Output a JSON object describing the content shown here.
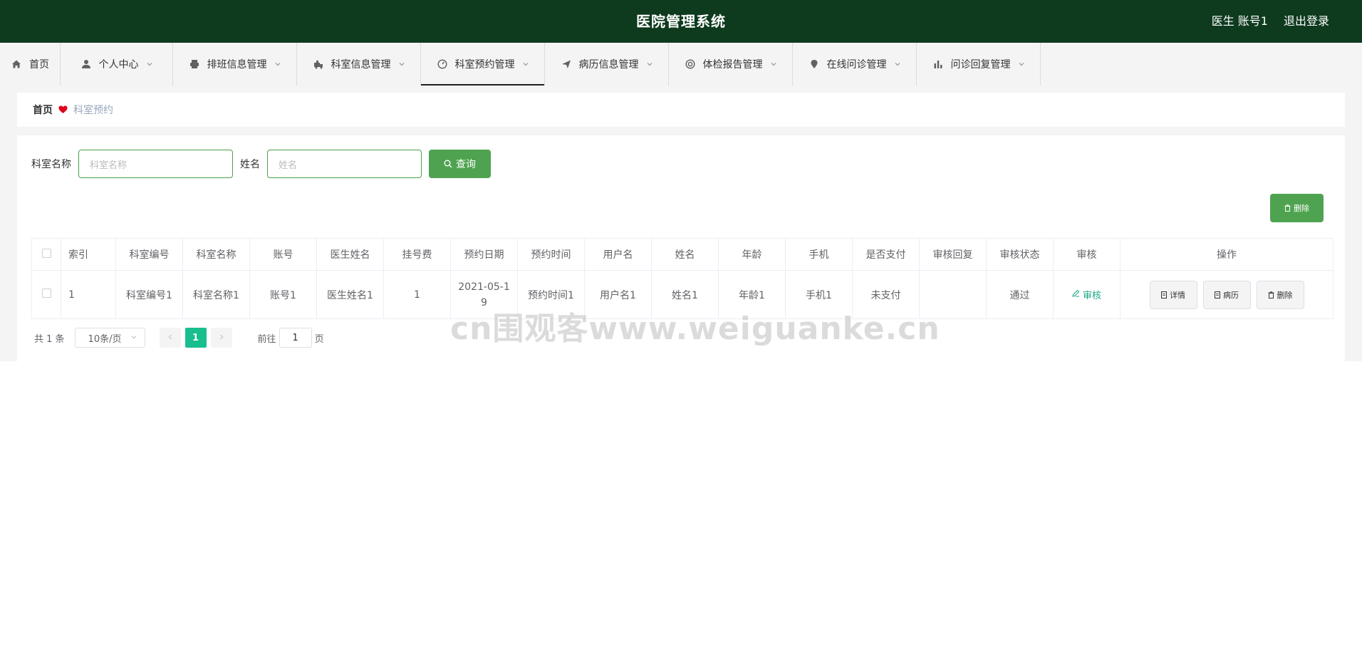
{
  "header": {
    "title": "医院管理系统",
    "user_label": "医生 账号1",
    "logout_label": "退出登录",
    "bg_color": "#0e3a1e"
  },
  "nav": {
    "items": [
      {
        "label": "首页",
        "icon": "home-icon",
        "has_dropdown": false
      },
      {
        "label": "个人中心",
        "icon": "user-icon",
        "has_dropdown": true
      },
      {
        "label": "排班信息管理",
        "icon": "printer-icon",
        "has_dropdown": true
      },
      {
        "label": "科室信息管理",
        "icon": "truck-icon",
        "has_dropdown": true
      },
      {
        "label": "科室预约管理",
        "icon": "dashboard-icon",
        "has_dropdown": true,
        "active": true
      },
      {
        "label": "病历信息管理",
        "icon": "send-icon",
        "has_dropdown": true
      },
      {
        "label": "体检报告管理",
        "icon": "lifebuoy-icon",
        "has_dropdown": true
      },
      {
        "label": "在线问诊管理",
        "icon": "location-pin-icon",
        "has_dropdown": true
      },
      {
        "label": "问诊回复管理",
        "icon": "bar-chart-icon",
        "has_dropdown": true
      }
    ]
  },
  "breadcrumb": {
    "home": "首页",
    "current": "科室预约"
  },
  "search": {
    "dept_label": "科室名称",
    "dept_placeholder": "科室名称",
    "name_label": "姓名",
    "name_placeholder": "姓名",
    "query_label": "查询"
  },
  "toolbar": {
    "delete_label": "删除"
  },
  "table": {
    "headers": [
      "索引",
      "科室编号",
      "科室名称",
      "账号",
      "医生姓名",
      "挂号费",
      "预约日期",
      "预约时间",
      "用户名",
      "姓名",
      "年龄",
      "手机",
      "是否支付",
      "审核回复",
      "审核状态",
      "审核",
      "操作"
    ],
    "rows": [
      {
        "index": "1",
        "dept_no": "科室编号1",
        "dept_name": "科室名称1",
        "account": "账号1",
        "doctor": "医生姓名1",
        "fee": "1",
        "date": "2021-05-19",
        "time": "预约时间1",
        "username": "用户名1",
        "name": "姓名1",
        "age": "年龄1",
        "phone": "手机1",
        "paid": "未支付",
        "reply": "",
        "status": "通过",
        "audit_label": "审核",
        "actions": {
          "detail": "详情",
          "record": "病历",
          "delete": "删除"
        }
      }
    ]
  },
  "pagination": {
    "total": "共 1 条",
    "page_size": "10条/页",
    "current_page": "1",
    "goto_prefix": "前往",
    "goto_value": "1",
    "goto_suffix": "页"
  },
  "watermark": "cn围观客www.weiguanke.cn",
  "colors": {
    "primary": "#4fa350",
    "active_page": "#19be8f",
    "link": "#1ba784"
  }
}
